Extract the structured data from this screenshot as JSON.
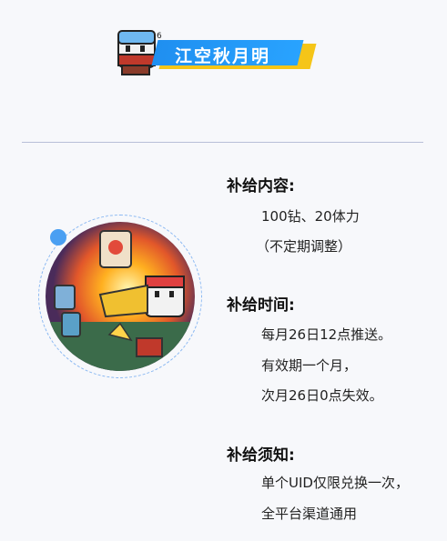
{
  "header": {
    "title": "江空秋月明",
    "colors": {
      "ribbon_blue": "#1f8ff0",
      "ribbon_yellow": "#f5c518"
    }
  },
  "art": {
    "description_icon": "game-art-image"
  },
  "sections": [
    {
      "title": "补给内容:",
      "lines": [
        "100钻、20体力",
        "（不定期调整）"
      ]
    },
    {
      "title": "补给时间:",
      "lines": [
        "每月26日12点推送。",
        "有效期一个月，",
        "次月26日0点失效。"
      ]
    },
    {
      "title": "补给须知:",
      "lines": [
        "单个UID仅限兑换一次，",
        "全平台渠道通用"
      ]
    }
  ]
}
